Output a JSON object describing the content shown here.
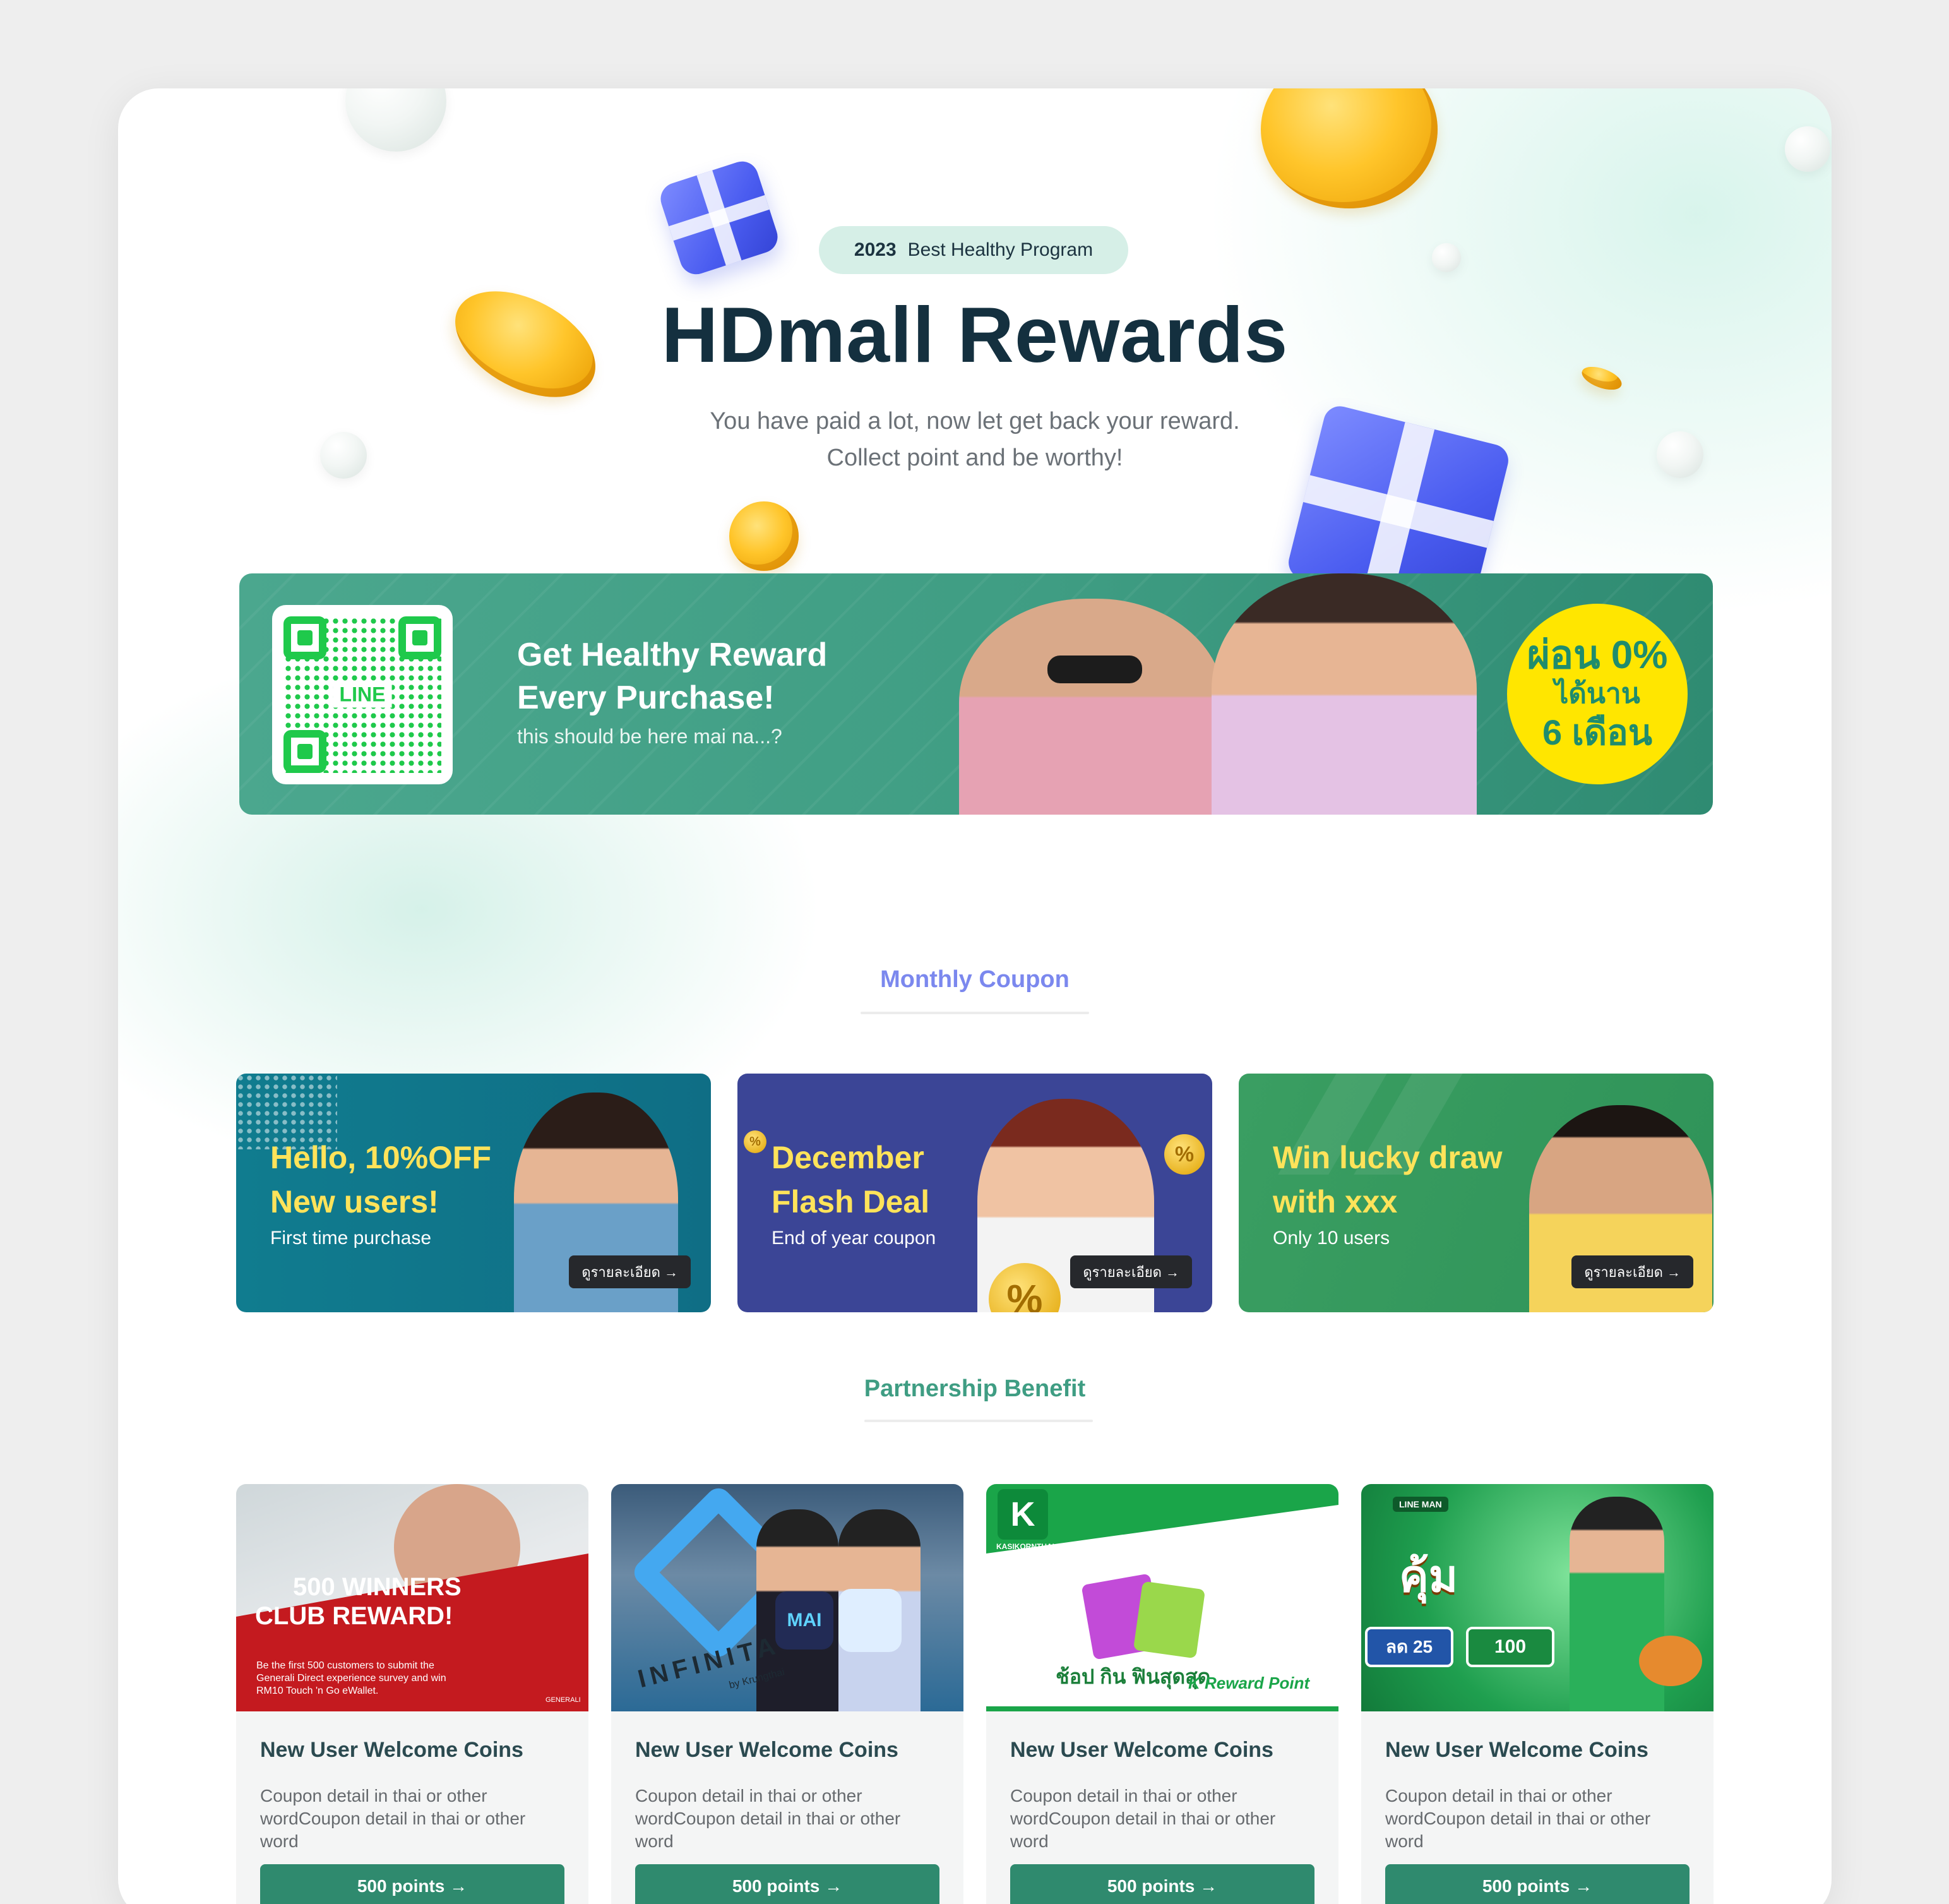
{
  "header": {
    "badge_year": "2023",
    "badge_label": "Best Healthy Program",
    "title": "HDmall Rewards",
    "subtitle_line1": "You have paid a lot, now let get back your reward.",
    "subtitle_line2": "Collect point and be worthy!"
  },
  "hero": {
    "qr_label": "LINE",
    "heading_line1": "Get Healthy Reward",
    "heading_line2": "Every Purchase!",
    "subtext": "this should be here mai na...?",
    "promo_line1": "ผ่อน 0%",
    "promo_line2": "ได้นาน",
    "promo_line3": "6 เดือน"
  },
  "monthly_coupon": {
    "section_title": "Monthly Coupon",
    "items": [
      {
        "line1": "Hello, 10%OFF",
        "line2": "New users!",
        "sub": "First time purchase",
        "button": "ดูรายละเอียด →"
      },
      {
        "line1": "December",
        "line2": "Flash Deal",
        "sub": "End of year coupon",
        "button": "ดูรายละเอียด →"
      },
      {
        "line1": "Win lucky draw",
        "line2": "with xxx",
        "sub": "Only 10 users",
        "button": "ดูรายละเอียด →"
      }
    ]
  },
  "partnership": {
    "section_title": "Partnership Benefit",
    "cards": [
      {
        "img_title1": "500 WINNERS",
        "img_title2": "CLUB REWARD!",
        "img_desc": "Be the first 500 customers to submit the Generali Direct experience survey and win RM10 Touch 'n Go eWallet.",
        "img_brand": "GENERALI",
        "title": "New User Welcome Coins",
        "desc": "Coupon detail in thai or other wordCoupon detail in thai or other word",
        "button": "500 points →"
      },
      {
        "img_title1": "INFINITA",
        "img_title2": "by Krungthai",
        "title": "New User Welcome Coins",
        "desc": "Coupon detail in thai or other wordCoupon detail in thai or other word",
        "button": "500 points →"
      },
      {
        "img_title1": "KASIKORNTHAI",
        "img_title2": "ช้อป กิน ฟินสุดสุด",
        "img_brand": "K Reward Point",
        "title": "New User Welcome Coins",
        "desc": "Coupon detail in thai or other wordCoupon detail in thai or other word",
        "button": "500 points →"
      },
      {
        "img_title1": "LINE MAN",
        "img_title2": "คุ้ม",
        "img_badge1": "ลด 25",
        "img_badge2": "100",
        "title": "New User Welcome Coins",
        "desc": "Coupon detail in thai or other wordCoupon detail in thai or other word",
        "button": "500 points →"
      }
    ]
  },
  "colors": {
    "brand_green": "#2f8a6e",
    "coupon_heading": "#7b88ee",
    "partner_heading": "#3f9d83",
    "promo_yellow": "#ffe600"
  }
}
